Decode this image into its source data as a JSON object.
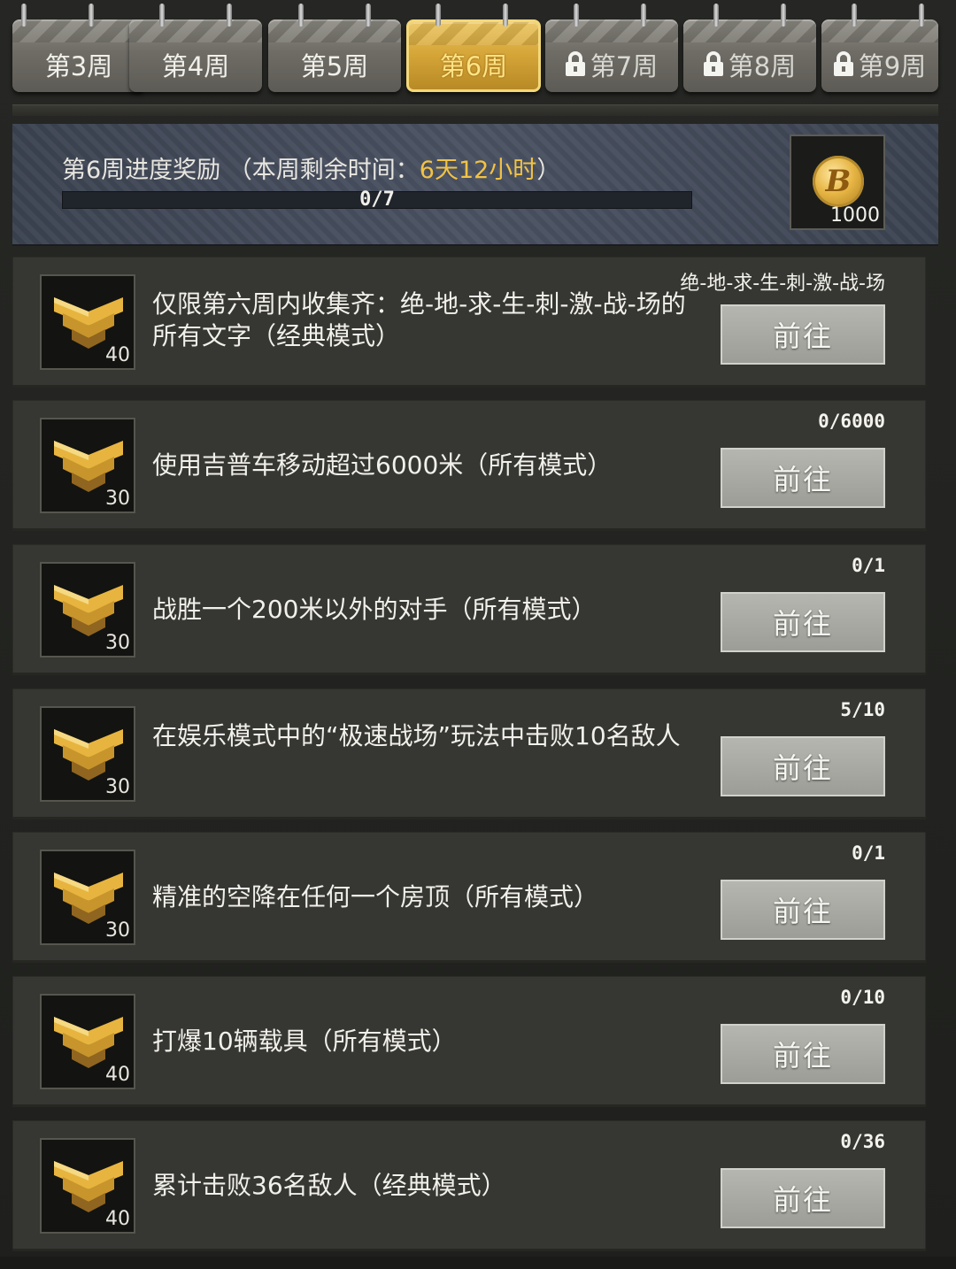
{
  "tabs": [
    {
      "label": "第3周",
      "state": "normal"
    },
    {
      "label": "第4周",
      "state": "normal"
    },
    {
      "label": "第5周",
      "state": "normal"
    },
    {
      "label": "第6周",
      "state": "active"
    },
    {
      "label": "第7周",
      "state": "locked"
    },
    {
      "label": "第8周",
      "state": "locked"
    },
    {
      "label": "第9周",
      "state": "locked"
    }
  ],
  "header": {
    "title_prefix": "第6周进度奖励 （本周剩余时间：",
    "time_remaining": "6天12小时",
    "title_suffix": "）",
    "progress_text": "0/7",
    "progress_fraction": 0,
    "reward_amount": "1000",
    "reward_icon": "coin-icon"
  },
  "tasks": [
    {
      "points": "40",
      "text": "仅限第六周内收集齐：绝-地-求-生-刺-激-战-场的所有文字（经典模式）",
      "progress": "绝-地-求-生-刺-激-战-场",
      "button": "前往"
    },
    {
      "points": "30",
      "text": "使用吉普车移动超过6000米（所有模式）",
      "progress": "0/6000",
      "button": "前往"
    },
    {
      "points": "30",
      "text": "战胜一个200米以外的对手（所有模式）",
      "progress": "0/1",
      "button": "前往"
    },
    {
      "points": "30",
      "text": "在娱乐模式中的“极速战场”玩法中击败10名敌人",
      "progress": "5/10",
      "button": "前往"
    },
    {
      "points": "30",
      "text": "精准的空降在任何一个房顶（所有模式）",
      "progress": "0/1",
      "button": "前往"
    },
    {
      "points": "40",
      "text": "打爆10辆载具（所有模式）",
      "progress": "0/10",
      "button": "前往"
    },
    {
      "points": "40",
      "text": "累计击败36名敌人（经典模式）",
      "progress": "0/36",
      "button": "前往"
    }
  ],
  "colors": {
    "accent_gold": "#f2c245",
    "button_gray": "#a9a9a3",
    "panel_blue": "#434a59"
  }
}
